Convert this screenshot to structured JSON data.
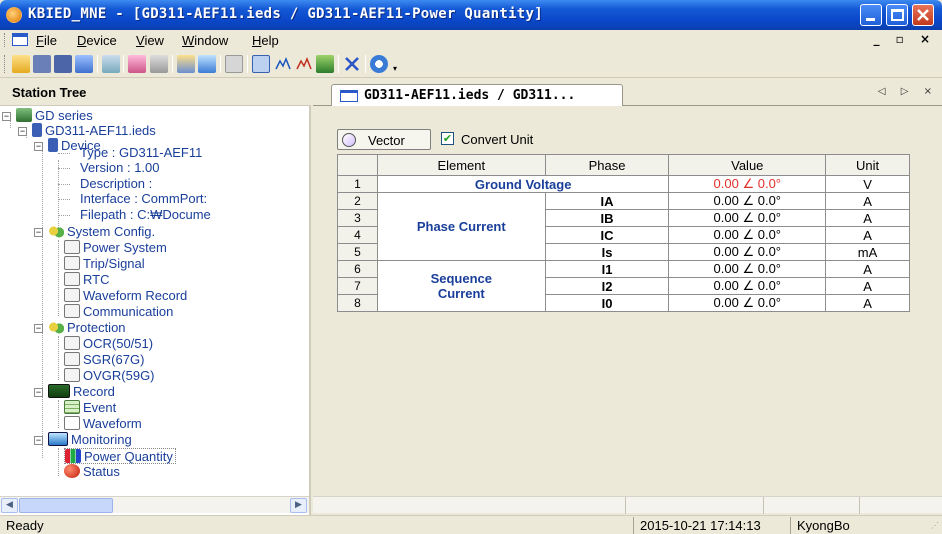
{
  "window": {
    "title": "KBIED_MNE - [GD311-AEF11.ieds / GD311-AEF11-Power Quantity]"
  },
  "menu": {
    "items": [
      "File",
      "Device",
      "View",
      "Window",
      "Help"
    ],
    "mdi_controls": "_ Д ×"
  },
  "toolbar": {
    "icons": [
      "open-folder-icon",
      "save-icon",
      "save-all-icon",
      "device-icon",
      "list-icon",
      "config-icon",
      "settings-icon",
      "connect-icon",
      "monitor-icon",
      "grid-icon",
      "window-icon",
      "waveform-icon",
      "waveform-icon",
      "export-icon",
      "delete-icon",
      "help-icon"
    ]
  },
  "station_tree": {
    "header": "Station Tree",
    "root": "GD series",
    "file": "GD311-AEF11.ieds",
    "device": {
      "label": "Device",
      "type": "Type : GD311-AEF11",
      "version": "Version : 1.00",
      "description": "Description :",
      "interface": "Interface : CommPort:",
      "filepath": "Filepath : C:₩Docume"
    },
    "system_config": {
      "label": "System Config.",
      "items": [
        "Power System",
        "Trip/Signal",
        "RTC",
        "Waveform Record",
        "Communication"
      ]
    },
    "protection": {
      "label": "Protection",
      "items": [
        "OCR(50/51)",
        "SGR(67G)",
        "OVGR(59G)"
      ]
    },
    "record": {
      "label": "Record",
      "items": [
        "Event",
        "Waveform"
      ]
    },
    "monitoring": {
      "label": "Monitoring",
      "items": [
        "Power Quantity",
        "Status"
      ]
    }
  },
  "document": {
    "tab_label": "GD311-AEF11.ieds / GD311...",
    "tab_nav": "◁ ▷ ×",
    "vector_button": "Vector",
    "convert_unit_label": "Convert Unit",
    "convert_unit_checked": true,
    "columns": [
      "Element",
      "Phase",
      "Value",
      "Unit"
    ],
    "ground_voltage": "Ground Voltage",
    "phase_current": "Phase Current",
    "sequence_current_1": "Sequence",
    "sequence_current_2": "Current",
    "rows": [
      {
        "num": "1",
        "phase": "",
        "value": "0.00 ∠ 0.0°",
        "unit": "V"
      },
      {
        "num": "2",
        "phase": "IA",
        "value": "0.00 ∠ 0.0°",
        "unit": "A"
      },
      {
        "num": "3",
        "phase": "IB",
        "value": "0.00 ∠ 0.0°",
        "unit": "A"
      },
      {
        "num": "4",
        "phase": "IC",
        "value": "0.00 ∠ 0.0°",
        "unit": "A"
      },
      {
        "num": "5",
        "phase": "Is",
        "value": "0.00 ∠ 0.0°",
        "unit": "mA"
      },
      {
        "num": "6",
        "phase": "I1",
        "value": "0.00 ∠ 0.0°",
        "unit": "A"
      },
      {
        "num": "7",
        "phase": "I2",
        "value": "0.00 ∠ 0.0°",
        "unit": "A"
      },
      {
        "num": "8",
        "phase": "I0",
        "value": "0.00 ∠ 0.0°",
        "unit": "A"
      }
    ],
    "highlight_color": "#e0302a"
  },
  "status": {
    "ready": "Ready",
    "datetime": "2015-10-21 17:14:13",
    "user": "KyongBo"
  },
  "colors": {
    "title_bar": "#0a47c8",
    "tree_text": "#1a3f9a"
  }
}
